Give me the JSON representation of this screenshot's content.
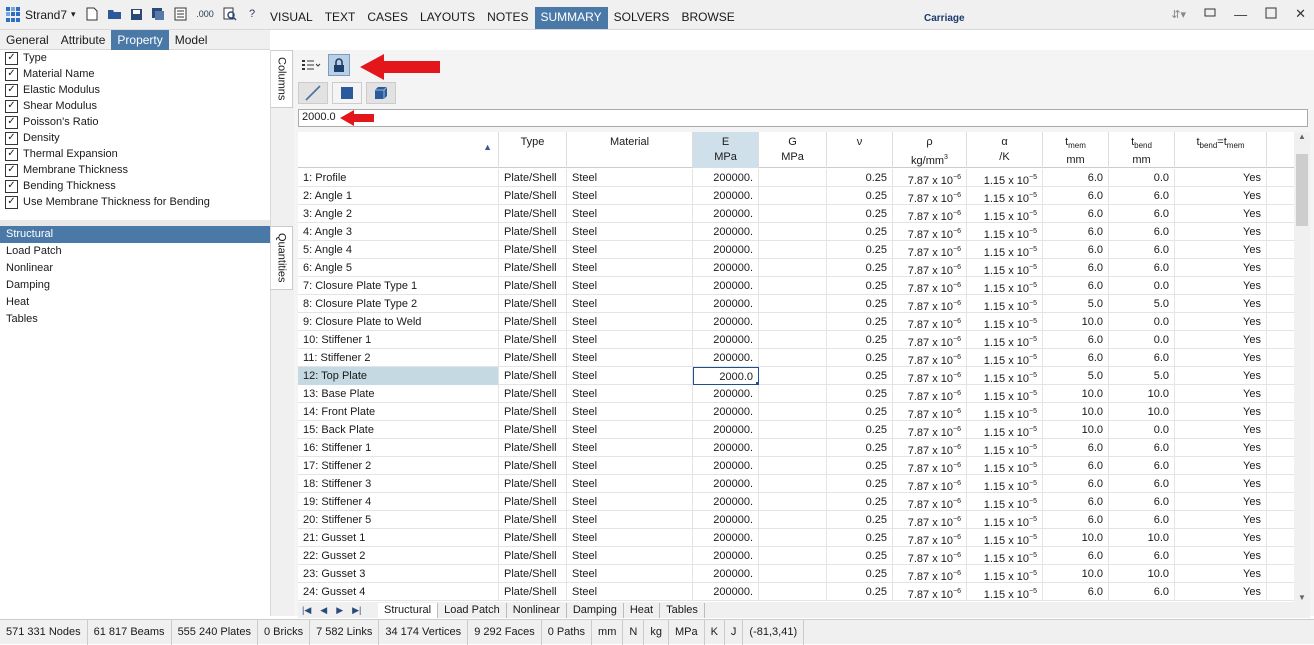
{
  "app": {
    "name": "Strand7",
    "window_title": "Carriage"
  },
  "menu": [
    "VISUAL",
    "TEXT",
    "CASES",
    "LAYOUTS",
    "NOTES",
    "SUMMARY",
    "SOLVERS",
    "BROWSE"
  ],
  "left_tabs": [
    "General",
    "Attribute",
    "Property",
    "Model"
  ],
  "columns": [
    "Type",
    "Material Name",
    "Elastic Modulus",
    "Shear Modulus",
    "Poisson's Ratio",
    "Density",
    "Thermal Expansion",
    "Membrane Thickness",
    "Bending Thickness",
    "Use Membrane Thickness for Bending"
  ],
  "categories": [
    "Structural",
    "Load Patch",
    "Nonlinear",
    "Damping",
    "Heat",
    "Tables"
  ],
  "side_tabs": {
    "columns": "Columns",
    "quantities": "Quantities"
  },
  "edit_value": "2000.0",
  "headers": {
    "type": "Type",
    "material": "Material",
    "E": "E",
    "E_unit": "MPa",
    "G": "G",
    "G_unit": "MPa",
    "nu": "ν",
    "rho": "ρ",
    "rho_unit": "kg/mm",
    "rho_exp": "3",
    "alpha": "α",
    "alpha_unit": "/K",
    "tmem": "t",
    "tmem_sub": "mem",
    "tmem_unit": "mm",
    "tbend": "t",
    "tbend_sub": "bend",
    "tbend_unit": "mm",
    "tbeq_t1": "t",
    "tbeq_sub1": "bend",
    "tbeq_mid": "=t",
    "tbeq_sub2": "mem"
  },
  "rows": [
    {
      "name": "1: Profile",
      "type": "Plate/Shell",
      "mat": "Steel",
      "E": "200000.",
      "nu": "0.25",
      "tmem": "6.0",
      "tbend": "0.0",
      "use": "Yes"
    },
    {
      "name": "2: Angle 1",
      "type": "Plate/Shell",
      "mat": "Steel",
      "E": "200000.",
      "nu": "0.25",
      "tmem": "6.0",
      "tbend": "6.0",
      "use": "Yes"
    },
    {
      "name": "3: Angle 2",
      "type": "Plate/Shell",
      "mat": "Steel",
      "E": "200000.",
      "nu": "0.25",
      "tmem": "6.0",
      "tbend": "6.0",
      "use": "Yes"
    },
    {
      "name": "4: Angle 3",
      "type": "Plate/Shell",
      "mat": "Steel",
      "E": "200000.",
      "nu": "0.25",
      "tmem": "6.0",
      "tbend": "6.0",
      "use": "Yes"
    },
    {
      "name": "5: Angle 4",
      "type": "Plate/Shell",
      "mat": "Steel",
      "E": "200000.",
      "nu": "0.25",
      "tmem": "6.0",
      "tbend": "6.0",
      "use": "Yes"
    },
    {
      "name": "6: Angle 5",
      "type": "Plate/Shell",
      "mat": "Steel",
      "E": "200000.",
      "nu": "0.25",
      "tmem": "6.0",
      "tbend": "6.0",
      "use": "Yes"
    },
    {
      "name": "7: Closure Plate Type 1",
      "type": "Plate/Shell",
      "mat": "Steel",
      "E": "200000.",
      "nu": "0.25",
      "tmem": "6.0",
      "tbend": "0.0",
      "use": "Yes"
    },
    {
      "name": "8: Closure Plate Type 2",
      "type": "Plate/Shell",
      "mat": "Steel",
      "E": "200000.",
      "nu": "0.25",
      "tmem": "5.0",
      "tbend": "5.0",
      "use": "Yes"
    },
    {
      "name": "9: Closure Plate to Weld",
      "type": "Plate/Shell",
      "mat": "Steel",
      "E": "200000.",
      "nu": "0.25",
      "tmem": "10.0",
      "tbend": "0.0",
      "use": "Yes"
    },
    {
      "name": "10: Stiffener 1",
      "type": "Plate/Shell",
      "mat": "Steel",
      "E": "200000.",
      "nu": "0.25",
      "tmem": "6.0",
      "tbend": "0.0",
      "use": "Yes"
    },
    {
      "name": "11: Stiffener 2",
      "type": "Plate/Shell",
      "mat": "Steel",
      "E": "200000.",
      "nu": "0.25",
      "tmem": "6.0",
      "tbend": "6.0",
      "use": "Yes"
    },
    {
      "name": "12: Top Plate",
      "type": "Plate/Shell",
      "mat": "Steel",
      "E": "2000.0",
      "nu": "0.25",
      "tmem": "5.0",
      "tbend": "5.0",
      "use": "Yes"
    },
    {
      "name": "13: Base Plate",
      "type": "Plate/Shell",
      "mat": "Steel",
      "E": "200000.",
      "nu": "0.25",
      "tmem": "10.0",
      "tbend": "10.0",
      "use": "Yes"
    },
    {
      "name": "14: Front Plate",
      "type": "Plate/Shell",
      "mat": "Steel",
      "E": "200000.",
      "nu": "0.25",
      "tmem": "10.0",
      "tbend": "10.0",
      "use": "Yes"
    },
    {
      "name": "15: Back Plate",
      "type": "Plate/Shell",
      "mat": "Steel",
      "E": "200000.",
      "nu": "0.25",
      "tmem": "10.0",
      "tbend": "0.0",
      "use": "Yes"
    },
    {
      "name": "16: Stiffener 1",
      "type": "Plate/Shell",
      "mat": "Steel",
      "E": "200000.",
      "nu": "0.25",
      "tmem": "6.0",
      "tbend": "6.0",
      "use": "Yes"
    },
    {
      "name": "17: Stiffener 2",
      "type": "Plate/Shell",
      "mat": "Steel",
      "E": "200000.",
      "nu": "0.25",
      "tmem": "6.0",
      "tbend": "6.0",
      "use": "Yes"
    },
    {
      "name": "18: Stiffener 3",
      "type": "Plate/Shell",
      "mat": "Steel",
      "E": "200000.",
      "nu": "0.25",
      "tmem": "6.0",
      "tbend": "6.0",
      "use": "Yes"
    },
    {
      "name": "19: Stiffener 4",
      "type": "Plate/Shell",
      "mat": "Steel",
      "E": "200000.",
      "nu": "0.25",
      "tmem": "6.0",
      "tbend": "6.0",
      "use": "Yes"
    },
    {
      "name": "20: Stiffener 5",
      "type": "Plate/Shell",
      "mat": "Steel",
      "E": "200000.",
      "nu": "0.25",
      "tmem": "6.0",
      "tbend": "6.0",
      "use": "Yes"
    },
    {
      "name": "21: Gusset 1",
      "type": "Plate/Shell",
      "mat": "Steel",
      "E": "200000.",
      "nu": "0.25",
      "tmem": "10.0",
      "tbend": "10.0",
      "use": "Yes"
    },
    {
      "name": "22: Gusset 2",
      "type": "Plate/Shell",
      "mat": "Steel",
      "E": "200000.",
      "nu": "0.25",
      "tmem": "6.0",
      "tbend": "6.0",
      "use": "Yes"
    },
    {
      "name": "23: Gusset 3",
      "type": "Plate/Shell",
      "mat": "Steel",
      "E": "200000.",
      "nu": "0.25",
      "tmem": "10.0",
      "tbend": "10.0",
      "use": "Yes"
    },
    {
      "name": "24: Gusset 4",
      "type": "Plate/Shell",
      "mat": "Steel",
      "E": "200000.",
      "nu": "0.25",
      "tmem": "6.0",
      "tbend": "6.0",
      "use": "Yes"
    }
  ],
  "rho_value": {
    "base": "7.87 x 10",
    "exp": "−6"
  },
  "alpha_value": {
    "base": "1.15 x 10",
    "exp": "−5"
  },
  "sheet_tabs": [
    "Structural",
    "Load Patch",
    "Nonlinear",
    "Damping",
    "Heat",
    "Tables"
  ],
  "status": [
    "571 331 Nodes",
    "61 817 Beams",
    "555 240 Plates",
    "0 Bricks",
    "7 582 Links",
    "34 174 Vertices",
    "9 292 Faces",
    "0 Paths",
    "mm",
    "N",
    "kg",
    "MPa",
    "K",
    "J",
    "(-81,3,41)"
  ]
}
